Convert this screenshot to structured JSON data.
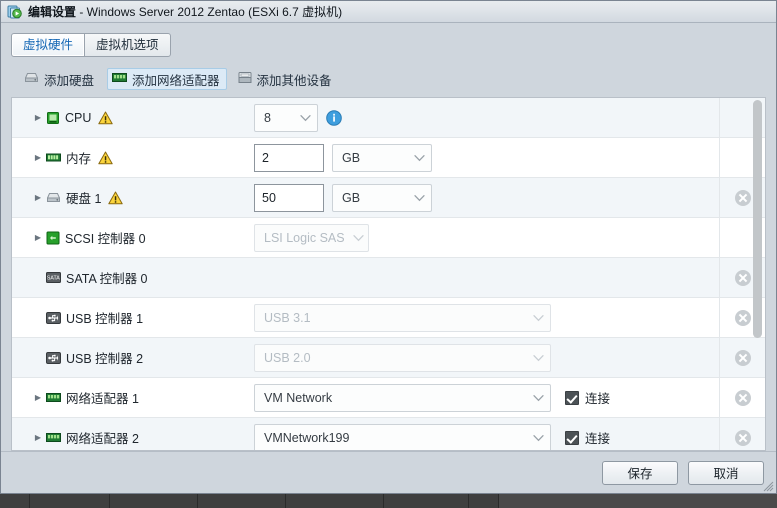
{
  "window": {
    "icon": "edit-settings-icon",
    "title_prefix": "编辑设置",
    "title_suffix": " - Windows Server 2012 Zentao (ESXi 6.7 虚拟机)"
  },
  "tabs": [
    {
      "label": "虚拟硬件",
      "active": true
    },
    {
      "label": "虚拟机选项",
      "active": false
    }
  ],
  "toolbar": [
    {
      "label": "添加硬盘",
      "icon": "hard-disk-icon",
      "highlighted": false
    },
    {
      "label": "添加网络适配器",
      "icon": "network-adapter-icon",
      "highlighted": true
    },
    {
      "label": "添加其他设备",
      "icon": "other-device-icon",
      "highlighted": false
    }
  ],
  "devices": [
    {
      "name": "CPU",
      "icon": "cpu-icon",
      "expandable": true,
      "warning": true,
      "control": "select",
      "value": "8",
      "select_width": "w70",
      "disabled": false,
      "info_icon": true,
      "unit": null,
      "connected": null,
      "removable": false
    },
    {
      "name": "内存",
      "icon": "memory-icon",
      "expandable": true,
      "warning": true,
      "control": "text",
      "value": "2",
      "unit": "GB",
      "unit_width": "w100",
      "disabled": false,
      "info_icon": false,
      "connected": null,
      "removable": false
    },
    {
      "name": "硬盘 1",
      "icon": "hard-disk-icon",
      "expandable": true,
      "warning": true,
      "control": "text",
      "value": "50",
      "unit": "GB",
      "unit_width": "w100",
      "disabled": false,
      "info_icon": false,
      "connected": null,
      "removable": true
    },
    {
      "name": "SCSI 控制器 0",
      "icon": "scsi-controller-icon",
      "expandable": true,
      "warning": false,
      "control": "select",
      "value": "LSI Logic SAS",
      "select_width": "w115",
      "disabled": true,
      "info_icon": false,
      "unit": null,
      "connected": null,
      "removable": false
    },
    {
      "name": "SATA 控制器 0",
      "icon": "sata-controller-icon",
      "expandable": false,
      "warning": false,
      "control": "none",
      "value": "",
      "disabled": false,
      "info_icon": false,
      "unit": null,
      "connected": null,
      "removable": true
    },
    {
      "name": "USB 控制器 1",
      "icon": "usb-controller-icon",
      "expandable": false,
      "warning": false,
      "control": "select",
      "value": "USB 3.1",
      "select_width": "w295",
      "disabled": true,
      "info_icon": false,
      "unit": null,
      "connected": null,
      "removable": true
    },
    {
      "name": "USB 控制器 2",
      "icon": "usb-controller-icon",
      "expandable": false,
      "warning": false,
      "control": "select",
      "value": "USB 2.0",
      "select_width": "w295",
      "disabled": true,
      "info_icon": false,
      "unit": null,
      "connected": null,
      "removable": true
    },
    {
      "name": "网络适配器 1",
      "icon": "network-adapter-icon",
      "expandable": true,
      "warning": false,
      "control": "select",
      "value": "VM Network",
      "select_width": "w295",
      "disabled": false,
      "info_icon": false,
      "unit": null,
      "connected": "连接",
      "removable": true
    },
    {
      "name": "网络适配器 2",
      "icon": "network-adapter-icon",
      "expandable": true,
      "warning": false,
      "control": "select",
      "value": "VMNetwork199",
      "select_width": "w295",
      "disabled": false,
      "info_icon": false,
      "unit": null,
      "connected": "连接",
      "removable": true
    }
  ],
  "footer": {
    "save_label": "保存",
    "cancel_label": "取消"
  },
  "colors": {
    "accent": "#1668b5",
    "window_bg": "#cfd6dd",
    "warning": "#f0c020",
    "highlight": "#dceaf6"
  }
}
